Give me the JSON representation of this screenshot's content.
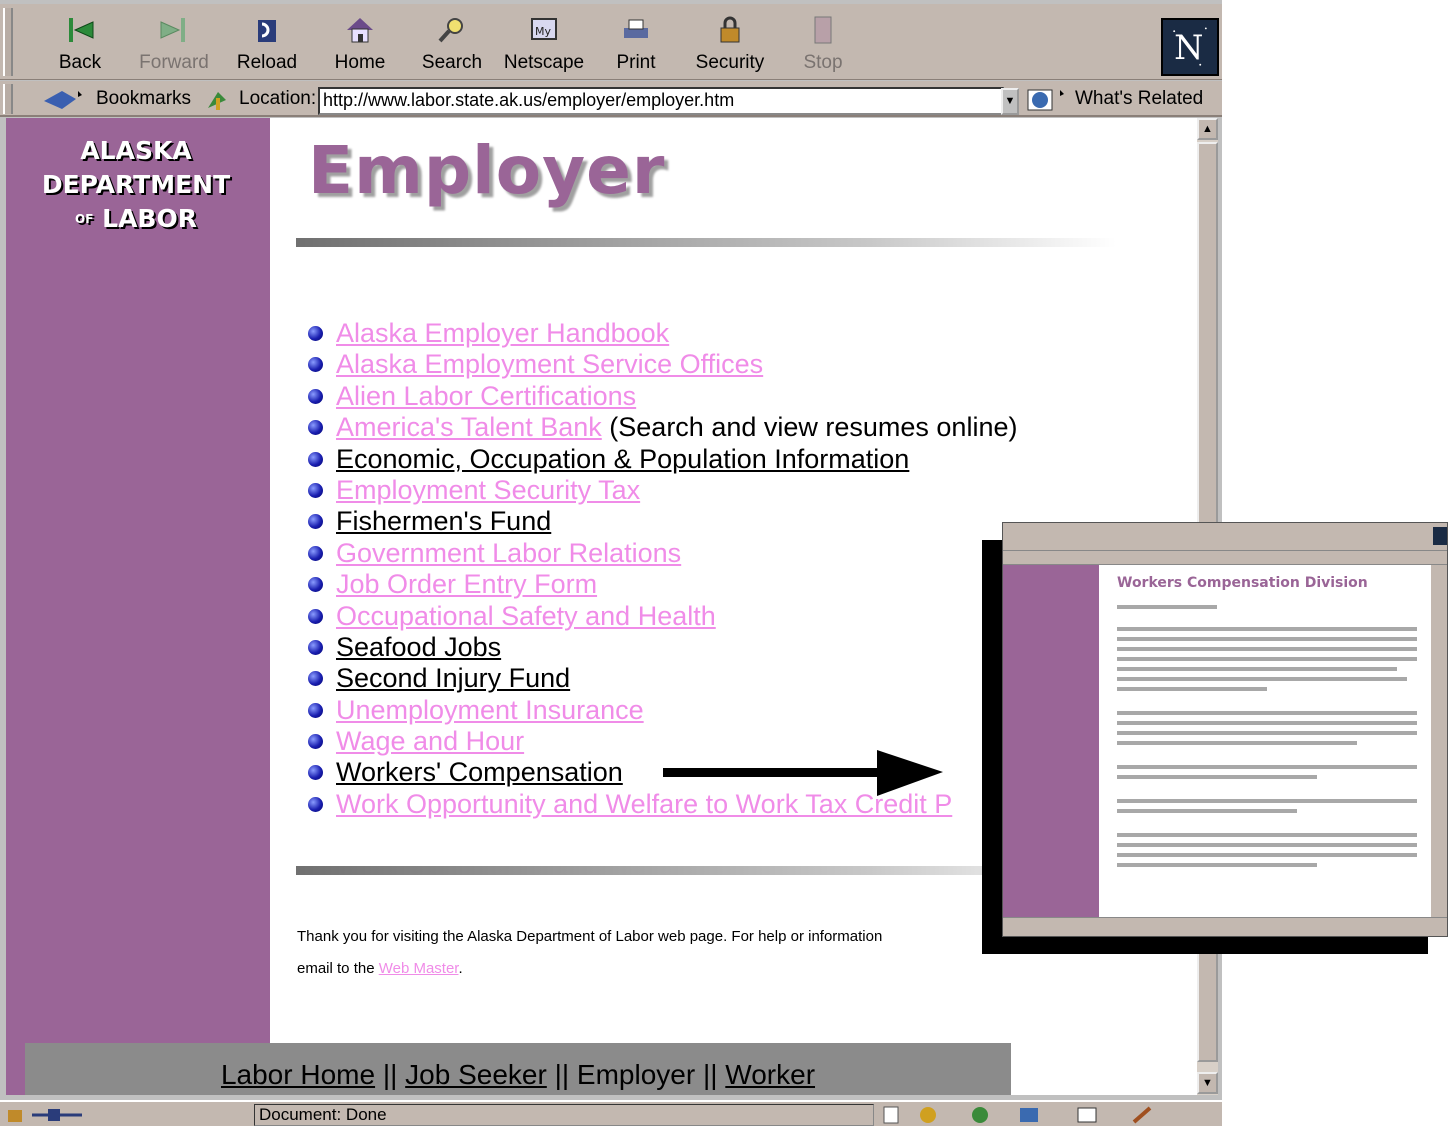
{
  "browser": {
    "toolbar": [
      {
        "name": "back",
        "label": "Back",
        "icon": "back-arrow-icon",
        "enabled": true
      },
      {
        "name": "forward",
        "label": "Forward",
        "icon": "forward-arrow-icon",
        "enabled": false
      },
      {
        "name": "reload",
        "label": "Reload",
        "icon": "reload-icon",
        "enabled": true
      },
      {
        "name": "home",
        "label": "Home",
        "icon": "home-icon",
        "enabled": true
      },
      {
        "name": "search",
        "label": "Search",
        "icon": "search-icon",
        "enabled": true
      },
      {
        "name": "netscape",
        "label": "Netscape",
        "icon": "my-netscape-icon",
        "enabled": true
      },
      {
        "name": "print",
        "label": "Print",
        "icon": "printer-icon",
        "enabled": true
      },
      {
        "name": "security",
        "label": "Security",
        "icon": "lock-icon",
        "enabled": true
      },
      {
        "name": "stop",
        "label": "Stop",
        "icon": "stop-icon",
        "enabled": false
      }
    ],
    "logo_letter": "N",
    "location_bar": {
      "bookmarks_label": "Bookmarks",
      "location_label": "Location:",
      "url": "http://www.labor.state.ak.us/employer/employer.htm",
      "related_label": "What's Related"
    },
    "status": "Document: Done"
  },
  "page": {
    "logo": {
      "line1": "ALASKA",
      "line2": "DEPARTMENT",
      "line3_small": "OF",
      "line3": "LABOR"
    },
    "title": "Employer",
    "links": [
      {
        "label": "Alaska Employer Handbook",
        "style": "pink",
        "note": ""
      },
      {
        "label": "Alaska Employment Service Offices",
        "style": "pink",
        "note": ""
      },
      {
        "label": "Alien Labor Certifications",
        "style": "pink",
        "note": ""
      },
      {
        "label": "America's Talent Bank",
        "style": "pink",
        "note": " (Search and view resumes online)"
      },
      {
        "label": "Economic, Occupation & Population Information",
        "style": "black",
        "note": ""
      },
      {
        "label": "Employment Security Tax",
        "style": "pink",
        "note": ""
      },
      {
        "label": "Fishermen's Fund",
        "style": "black",
        "note": ""
      },
      {
        "label": "Government Labor Relations",
        "style": "pink",
        "note": ""
      },
      {
        "label": "Job Order Entry Form",
        "style": "pink",
        "note": ""
      },
      {
        "label": "Occupational Safety and Health",
        "style": "pink",
        "note": ""
      },
      {
        "label": "Seafood Jobs",
        "style": "black",
        "note": ""
      },
      {
        "label": "Second Injury Fund",
        "style": "black",
        "note": ""
      },
      {
        "label": "Unemployment Insurance",
        "style": "pink",
        "note": ""
      },
      {
        "label": "Wage and Hour",
        "style": "pink",
        "note": ""
      },
      {
        "label": "Workers' Compensation",
        "style": "black",
        "note": ""
      },
      {
        "label": "Work Opportunity and Welfare to Work Tax Credit P",
        "style": "pink",
        "note": ""
      }
    ],
    "footer": {
      "line1": "Thank you for visiting the Alaska Department of Labor web page. For help or information",
      "line2_prefix": "email to the ",
      "webmaster_link": "Web Master",
      "line2_suffix": "."
    },
    "bottom_nav": {
      "labor_home": "Labor Home",
      "job_seeker": "Job Seeker",
      "employer": "Employer",
      "worker": "Worker",
      "separator": " || "
    }
  },
  "inset": {
    "heading": "Workers Compensation Division"
  },
  "colors": {
    "sidebar": "#9a6597",
    "link_pink": "#f08ce8",
    "chrome": "#c3b8b0"
  }
}
